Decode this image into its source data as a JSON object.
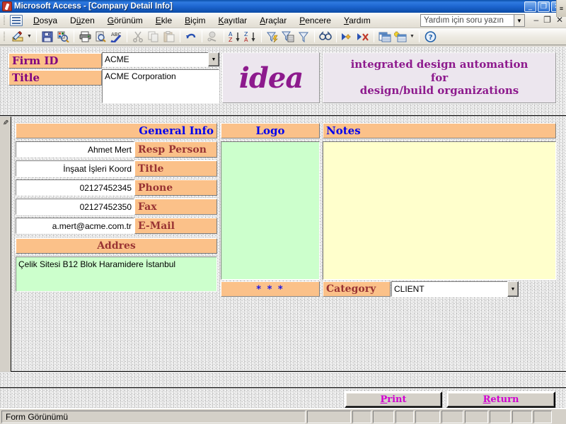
{
  "window": {
    "title": "Microsoft Access - [Company Detail Info]",
    "app_icon": "access-key-icon",
    "minimize": "_",
    "restore": "❐",
    "close": "✕"
  },
  "menubar": {
    "items": [
      {
        "label": "Dosya",
        "accel": "D"
      },
      {
        "label": "Düzen",
        "accel": "z"
      },
      {
        "label": "Görünüm",
        "accel": "G"
      },
      {
        "label": "Ekle",
        "accel": "E"
      },
      {
        "label": "Biçim",
        "accel": "B"
      },
      {
        "label": "Kayıtlar",
        "accel": "K"
      },
      {
        "label": "Araçlar",
        "accel": "A"
      },
      {
        "label": "Pencere",
        "accel": "P"
      },
      {
        "label": "Yardım",
        "accel": "Y"
      }
    ],
    "ask_box_placeholder": "Yardım için soru yazın",
    "mdi_minimize": "–",
    "mdi_restore": "❐",
    "mdi_close": "✕"
  },
  "toolbar": {
    "buttons": [
      "view-design-icon",
      "view-dropdown-arrow",
      "save-icon",
      "print-preview-layout-icon",
      "print-icon",
      "print-preview-icon",
      "spelling-check-icon",
      "cut-icon",
      "copy-icon",
      "paste-icon",
      "undo-icon",
      "insert-hyperlink-icon",
      "sort-ascending-icon",
      "sort-descending-icon",
      "filter-by-selection-icon",
      "filter-by-form-icon",
      "apply-filter-icon",
      "find-icon",
      "new-record-icon",
      "delete-record-icon",
      "database-window-icon",
      "new-object-icon",
      "new-object-dropdown-arrow",
      "help-icon"
    ],
    "overflow": "≡"
  },
  "header": {
    "firm_id": {
      "label": "Firm ID",
      "value": "ACME"
    },
    "title": {
      "label": "Title",
      "value": "ACME Corporation"
    },
    "logo_word": "idea",
    "banner_lines": [
      "integrated design automation",
      "for",
      "design/build organizations"
    ]
  },
  "detail": {
    "general_info_header": "General Info",
    "logo_header": "Logo",
    "notes_header": "Notes",
    "fields": [
      {
        "label": "Resp Person",
        "value": "Ahmet Mert"
      },
      {
        "label": "Title",
        "value": "İnşaat İşleri Koord"
      },
      {
        "label": "Phone",
        "value": "02127452345"
      },
      {
        "label": "Fax",
        "value": "02127452350"
      },
      {
        "label": "E-Mail",
        "value": "a.mert@acme.com.tr"
      }
    ],
    "address_header": "Addres",
    "address_value": "Çelik Sitesi B12 Blok Haramidere İstanbul",
    "stars": "* * *",
    "notes_value": "",
    "category": {
      "label": "Category",
      "value": "CLIENT"
    }
  },
  "footer": {
    "print_button": {
      "accel": "P",
      "rest": "rint"
    },
    "return_button": {
      "accel": "R",
      "rest": "eturn"
    }
  },
  "statusbar": {
    "message": "Form Görünümü"
  },
  "colors": {
    "title_bar": "#1b63cd",
    "label_orange": "#fbc189",
    "header_blue": "#0000ee",
    "field_label_maroon": "#993333",
    "logo_purple": "#8d1a8d",
    "button_magenta": "#d000d0",
    "memo_green": "#ccffcc",
    "memo_yellow": "#ffffcc",
    "form_gray": "#d2d2d2"
  }
}
